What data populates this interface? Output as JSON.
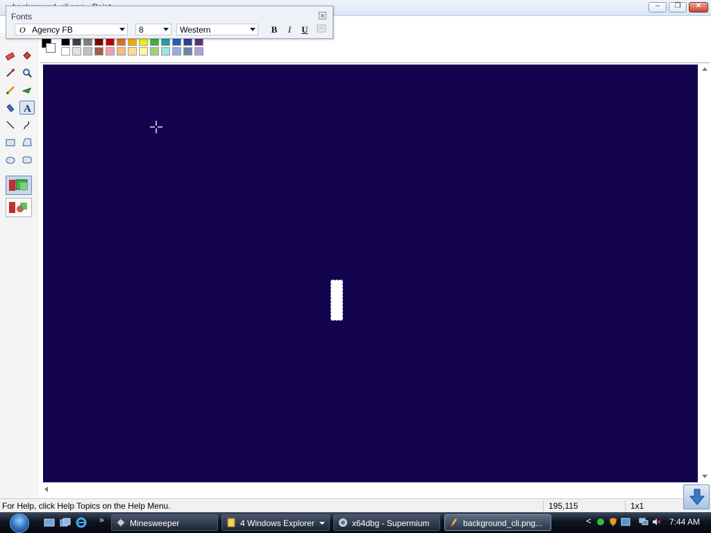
{
  "window": {
    "title": "background_cli.png - Paint"
  },
  "fonts_toolbar": {
    "title": "Fonts",
    "font_name": "Agency FB",
    "font_size": "8",
    "script": "Western",
    "bold_label": "B",
    "italic_label": "I",
    "underline_label": "U"
  },
  "canvas": {
    "background_color": "#14034e"
  },
  "status": {
    "help_text": "For Help, click Help Topics on the Help Menu.",
    "coords": "195,115",
    "size": "1x1"
  },
  "palette": {
    "top_row": [
      "#000000",
      "#404040",
      "#808080",
      "#800000",
      "#c00000",
      "#e07020",
      "#f0b000",
      "#f0f000",
      "#40b040",
      "#20a0a0",
      "#2060c0",
      "#304090",
      "#603080"
    ],
    "bottom_row": [
      "#ffffff",
      "#e0e0e0",
      "#c0c0c0",
      "#a06040",
      "#f0a0b0",
      "#f0c080",
      "#f8e090",
      "#f8f8a0",
      "#a0d080",
      "#a0e0e8",
      "#90b0e0",
      "#7080b0",
      "#b0a0d0"
    ]
  },
  "taskbar": {
    "chevron": "»",
    "tasks": [
      {
        "label": "Minesweeper"
      },
      {
        "label": "4 Windows Explorer"
      },
      {
        "label": "x64dbg - Supermium"
      },
      {
        "label": "background_cli.png..."
      }
    ],
    "tray_arrow": "<",
    "clock": "7:44 AM"
  }
}
